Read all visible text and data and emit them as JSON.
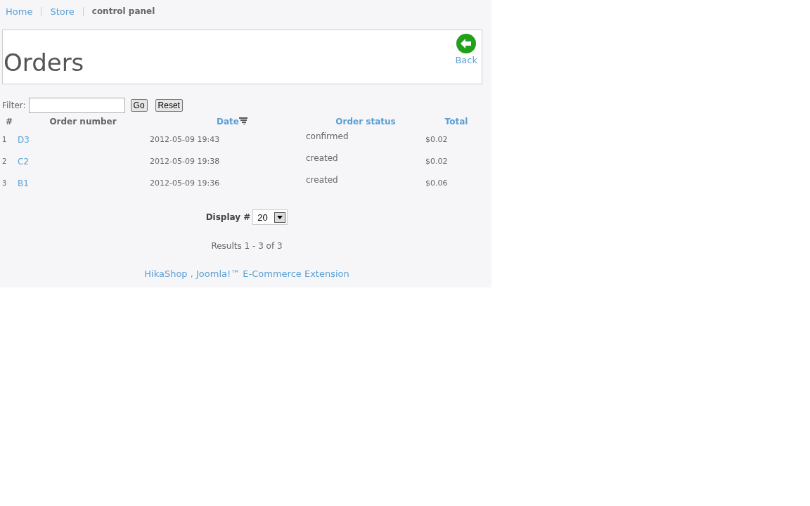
{
  "breadcrumbs": [
    {
      "label": "Home",
      "current": false
    },
    {
      "label": "Store",
      "current": false
    },
    {
      "label": "control panel",
      "current": true
    }
  ],
  "header": {
    "title": "Orders",
    "back_label": "Back"
  },
  "filter": {
    "label": "Filter:",
    "go": "Go",
    "reset": "Reset"
  },
  "table": {
    "columns": [
      {
        "label": "#",
        "sortable": false,
        "sorted": false
      },
      {
        "label": "Order number",
        "sortable": false,
        "sorted": false
      },
      {
        "label": "Date",
        "sortable": true,
        "sorted": true
      },
      {
        "label": "Order status",
        "sortable": true,
        "sorted": false
      },
      {
        "label": "Total",
        "sortable": true,
        "sorted": false
      }
    ],
    "rows": [
      {
        "index": "1",
        "number": "D3",
        "date": "2012-05-09 19:43",
        "status": "confirmed",
        "total": "$0.02"
      },
      {
        "index": "2",
        "number": "C2",
        "date": "2012-05-09 19:38",
        "status": "created",
        "total": "$0.02"
      },
      {
        "index": "3",
        "number": "B1",
        "date": "2012-05-09 19:36",
        "status": "created",
        "total": "$0.06"
      }
    ]
  },
  "pagination": {
    "display_label": "Display #",
    "display_value": "20",
    "results": "Results 1 - 3 of 3"
  },
  "footer": {
    "link": "HikaShop , Joomla!™ E-Commerce Extension"
  }
}
